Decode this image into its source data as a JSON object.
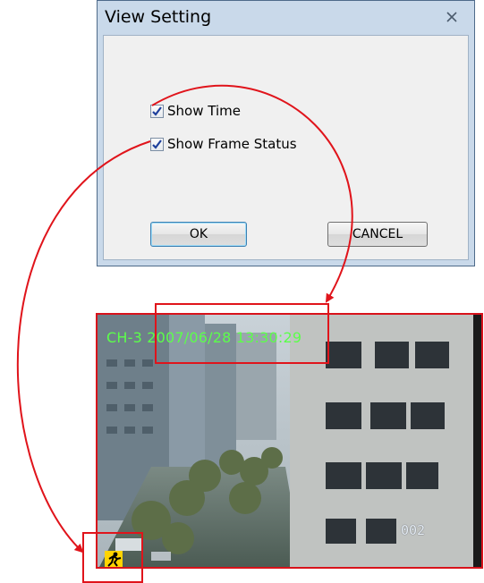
{
  "dialog": {
    "title": "View Setting",
    "show_time": {
      "label": "Show Time",
      "checked": true
    },
    "show_frame_status": {
      "label": "Show Frame Status",
      "checked": true
    },
    "ok_label": "OK",
    "cancel_label": "CANCEL"
  },
  "video": {
    "time_overlay": "CH-3 2007/06/28 13:30:29",
    "camera_number": "002"
  },
  "colors": {
    "annotation": "#e0141b",
    "osd_text": "#5cff4a"
  },
  "icons": [
    "close-icon",
    "checkmark-icon",
    "frame-status-icon"
  ]
}
